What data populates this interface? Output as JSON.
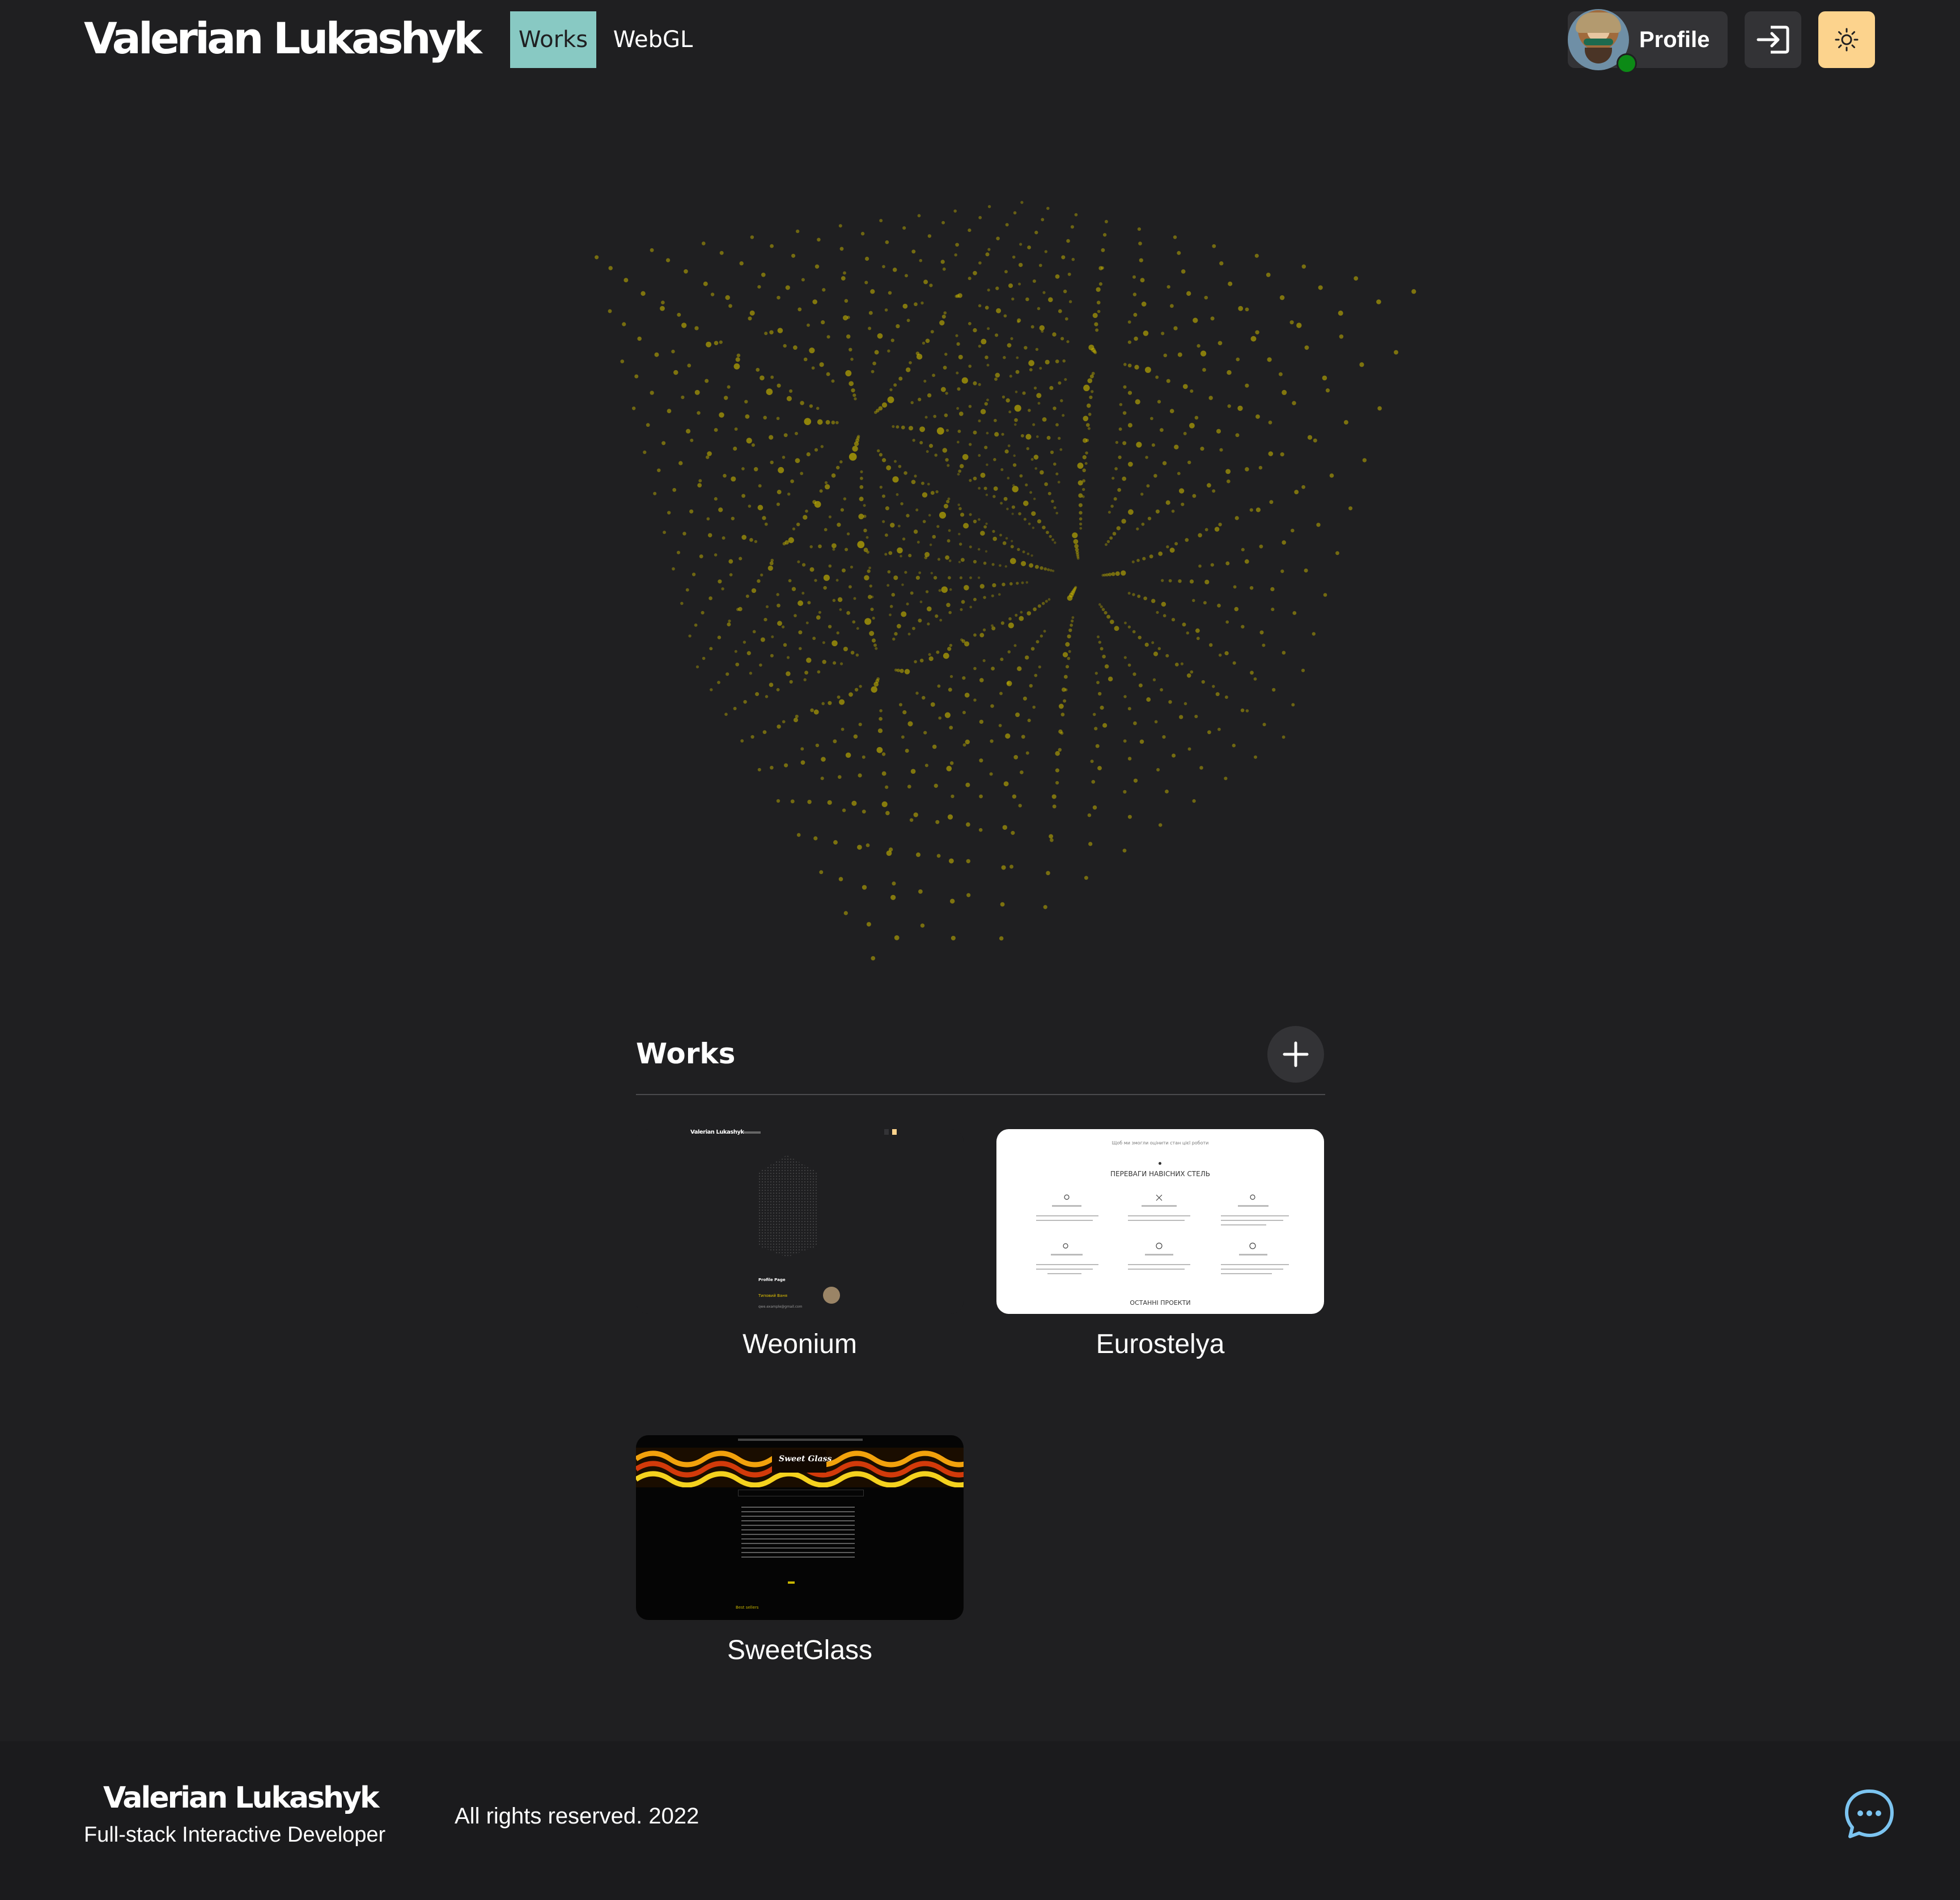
{
  "header": {
    "logo": "Valerian Lukashyk",
    "nav": [
      {
        "label": "Works",
        "active": true
      },
      {
        "label": "WebGL",
        "active": false
      }
    ],
    "profile_label": "Profile",
    "status": "online",
    "login_icon": "login-icon",
    "theme_icon": "sun-icon"
  },
  "works": {
    "title": "Works",
    "add_icon": "plus-icon",
    "items": [
      {
        "caption": "Weonium"
      },
      {
        "caption": "Eurostelya"
      },
      {
        "caption": "SweetGlass"
      }
    ]
  },
  "thumbs": {
    "weonium": {
      "logo": "Valerian Lukashyk",
      "profile": "Profile Page",
      "name": "Типовий Ваня",
      "email": "qwe.example@gmail.com"
    },
    "eurostelya": {
      "top_line": "Щоб ми змогли оцінити стан цієї роботи",
      "heading": "ПЕРЕВАГИ НАВІСНИХ СТЕЛЬ",
      "bottom": "ОСТАННІ ПРОЕКТИ"
    },
    "sweetglass": {
      "banner_text": "Sweet Glass",
      "more": "Best sellers"
    }
  },
  "footer": {
    "logo": "Valerian Lukashyk",
    "role": "Full-stack Interactive Developer",
    "rights": "All rights reserved. 2022",
    "chat_icon": "chat-icon"
  },
  "colors": {
    "background": "#1f1f21",
    "accent_teal": "#88c9c3",
    "accent_yellow": "#fcd38d",
    "particles": "#c8b600",
    "status_green": "#0c8a16",
    "chat_blue": "#7cc4f0"
  }
}
